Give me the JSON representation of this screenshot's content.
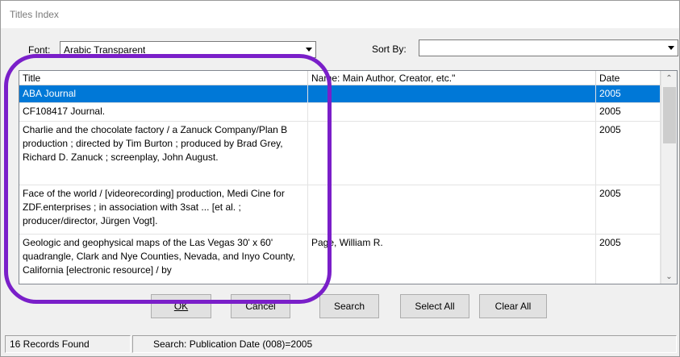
{
  "window": {
    "title": "Titles Index"
  },
  "controls": {
    "font_label": "Font:",
    "font_value": "Arabic Transparent",
    "sort_label": "Sort By:",
    "sort_value": ""
  },
  "grid": {
    "columns": [
      "Title",
      "Name: Main Author, Creator, etc.\"",
      "Date"
    ],
    "rows": [
      {
        "title": "ABA Journal",
        "name": "",
        "date": "2005",
        "selected": true
      },
      {
        "title": "CF108417 Journal.",
        "name": "",
        "date": "2005"
      },
      {
        "title": "Charlie and the chocolate factory / a Zanuck Company/Plan B production ; directed by Tim Burton ; produced by Brad Grey, Richard D. Zanuck ; screenplay, John August.",
        "name": "",
        "date": "2005"
      },
      {
        "title": "Face of the world / [videorecording] production, Medi Cine for ZDF.enterprises ; in association with 3sat ... [et al. ; producer/director, Jürgen Vogt].",
        "name": "",
        "date": "2005"
      },
      {
        "title": "Geologic and geophysical maps of the Las Vegas 30' x 60' quadrangle, Clark and Nye Counties, Nevada, and Inyo County, California [electronic resource] / by",
        "name": "Page, William R.",
        "date": "2005"
      }
    ]
  },
  "buttons": {
    "ok": "OK",
    "cancel": "Cancel",
    "search": "Search",
    "select_all": "Select All",
    "clear_all": "Clear All"
  },
  "status": {
    "records": "16 Records Found",
    "search": "Search: Publication Date (008)=2005"
  },
  "colors": {
    "selection": "#0078d7",
    "annotation": "#7a1fc9"
  }
}
